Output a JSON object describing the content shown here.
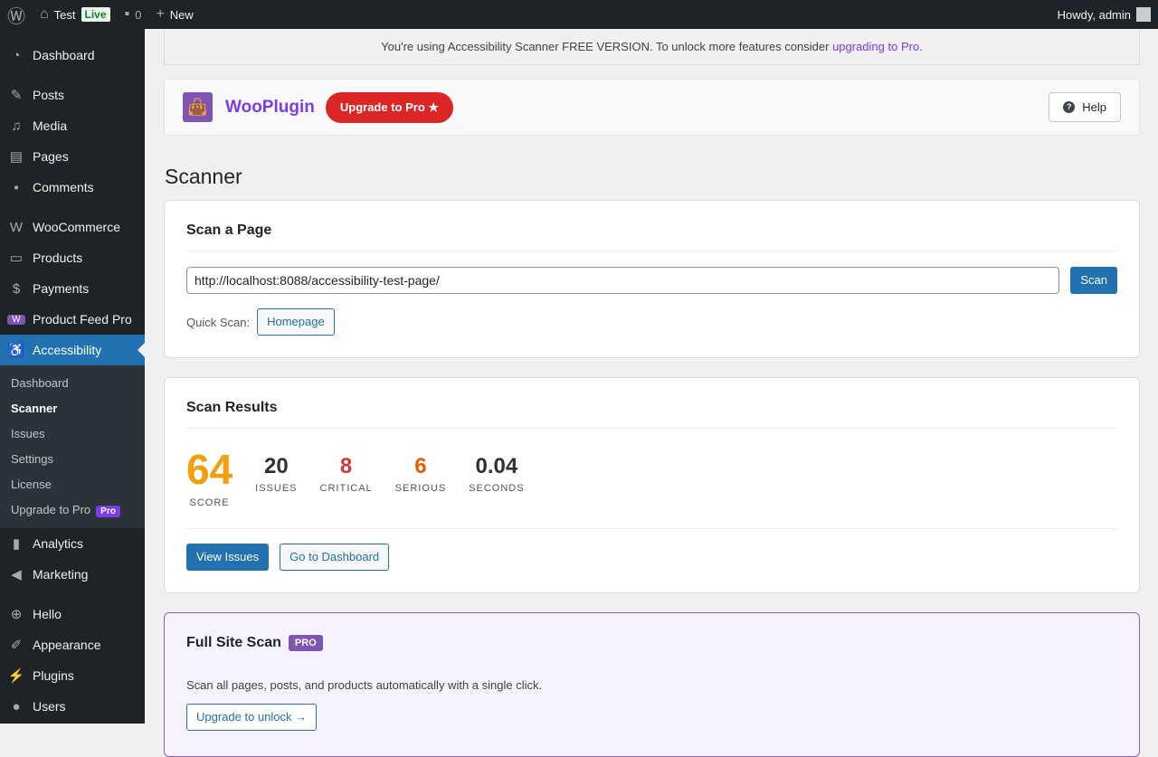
{
  "topbar": {
    "site": "Test",
    "live": "Live",
    "comments": "0",
    "new": "New",
    "howdy": "Howdy, admin"
  },
  "sidebar": {
    "items": [
      "Dashboard",
      "Posts",
      "Media",
      "Pages",
      "Comments",
      "WooCommerce",
      "Products",
      "Payments",
      "Product Feed Pro",
      "Accessibility",
      "Analytics",
      "Marketing",
      "Hello",
      "Appearance",
      "Plugins",
      "Users"
    ],
    "sub": [
      "Dashboard",
      "Scanner",
      "Issues",
      "Settings",
      "License",
      "Upgrade to Pro"
    ],
    "pro_badge": "Pro"
  },
  "notice": {
    "text": "You're using Accessibility Scanner FREE VERSION. To unlock more features consider ",
    "link": "upgrading to Pro",
    "end": "."
  },
  "header": {
    "brand": "WooPlugin",
    "upgrade": "Upgrade to Pro ★",
    "help": "Help"
  },
  "page_title": "Scanner",
  "scan": {
    "title": "Scan a Page",
    "url": "http://localhost:8088/accessibility-test-page/",
    "button": "Scan",
    "quick_label": "Quick Scan:",
    "quick_button": "Homepage"
  },
  "results": {
    "title": "Scan Results",
    "score": "64",
    "score_label": "SCORE",
    "issues": "20",
    "issues_label": "ISSUES",
    "critical": "8",
    "critical_label": "CRITICAL",
    "serious": "6",
    "serious_label": "SERIOUS",
    "seconds": "0.04",
    "seconds_label": "SECONDS",
    "view": "View Issues",
    "dash": "Go to Dashboard"
  },
  "full": {
    "title": "Full Site Scan",
    "badge": "PRO",
    "desc": "Scan all pages, posts, and products automatically with a single click.",
    "button": "Upgrade to unlock →"
  }
}
